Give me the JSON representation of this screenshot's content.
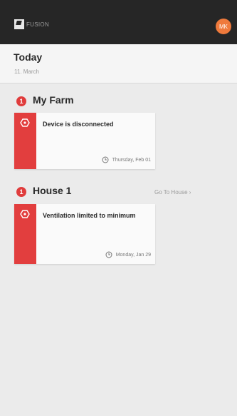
{
  "app": {
    "logo_text": "FUSION",
    "avatar_initials": "MK",
    "accent_color": "#ef7a3c",
    "alert_color": "#e23e3e"
  },
  "today": {
    "title": "Today",
    "date": "11. March"
  },
  "sections": [
    {
      "badge_count": "1",
      "title": "My Farm",
      "link_label": "",
      "alerts": [
        {
          "icon": "warning-gear-icon",
          "text": "Device is disconnected",
          "timestamp": "Thursday, Feb 01"
        }
      ]
    },
    {
      "badge_count": "1",
      "title": "House 1",
      "link_label": "Go To House  ›",
      "alerts": [
        {
          "icon": "warning-gear-icon",
          "text": "Ventilation limited to minimum",
          "timestamp": "Monday, Jan 29"
        }
      ]
    }
  ]
}
